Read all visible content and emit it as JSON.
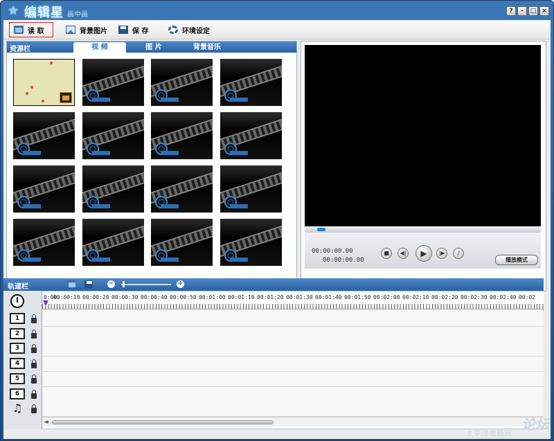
{
  "window": {
    "title": "编辑星",
    "subtitle": "画中画",
    "controls": [
      "?",
      "-",
      "□",
      "×"
    ]
  },
  "toolbar": {
    "read_label": "读 取",
    "background_label": "背景图片",
    "save_label": "保 存",
    "settings_label": "环境设定"
  },
  "resource": {
    "title": "资源栏",
    "tabs": [
      "视 频",
      "图 片",
      "背景音乐"
    ],
    "active_tab": "视 频",
    "thumbnail_count": 16
  },
  "player": {
    "time_current": "00:00:00.00",
    "time_total": "00:00:00.00",
    "mode_button": "播放模式",
    "buttons": [
      "stop",
      "prev-frame",
      "play",
      "next-frame",
      "volume"
    ]
  },
  "timeline": {
    "title": "轨道栏",
    "ruler_labels": [
      "0:00",
      "00:00:10",
      "00:00:20",
      "00:00:30",
      "00:00:40",
      "00:00:50",
      "00:01:00",
      "00:01:10",
      "00:01:20",
      "00:01:30",
      "00:01:40",
      "00:01:50",
      "00:02:00",
      "00:02:10",
      "00:02:20",
      "00:02:30",
      "00:02:40",
      "00:02"
    ],
    "tracks": [
      "1",
      "2",
      "3",
      "4",
      "5",
      "6",
      "♫"
    ],
    "scroll_left": "◄"
  },
  "watermark": {
    "text": "论坛",
    "sub": "太平洋电脑网"
  }
}
